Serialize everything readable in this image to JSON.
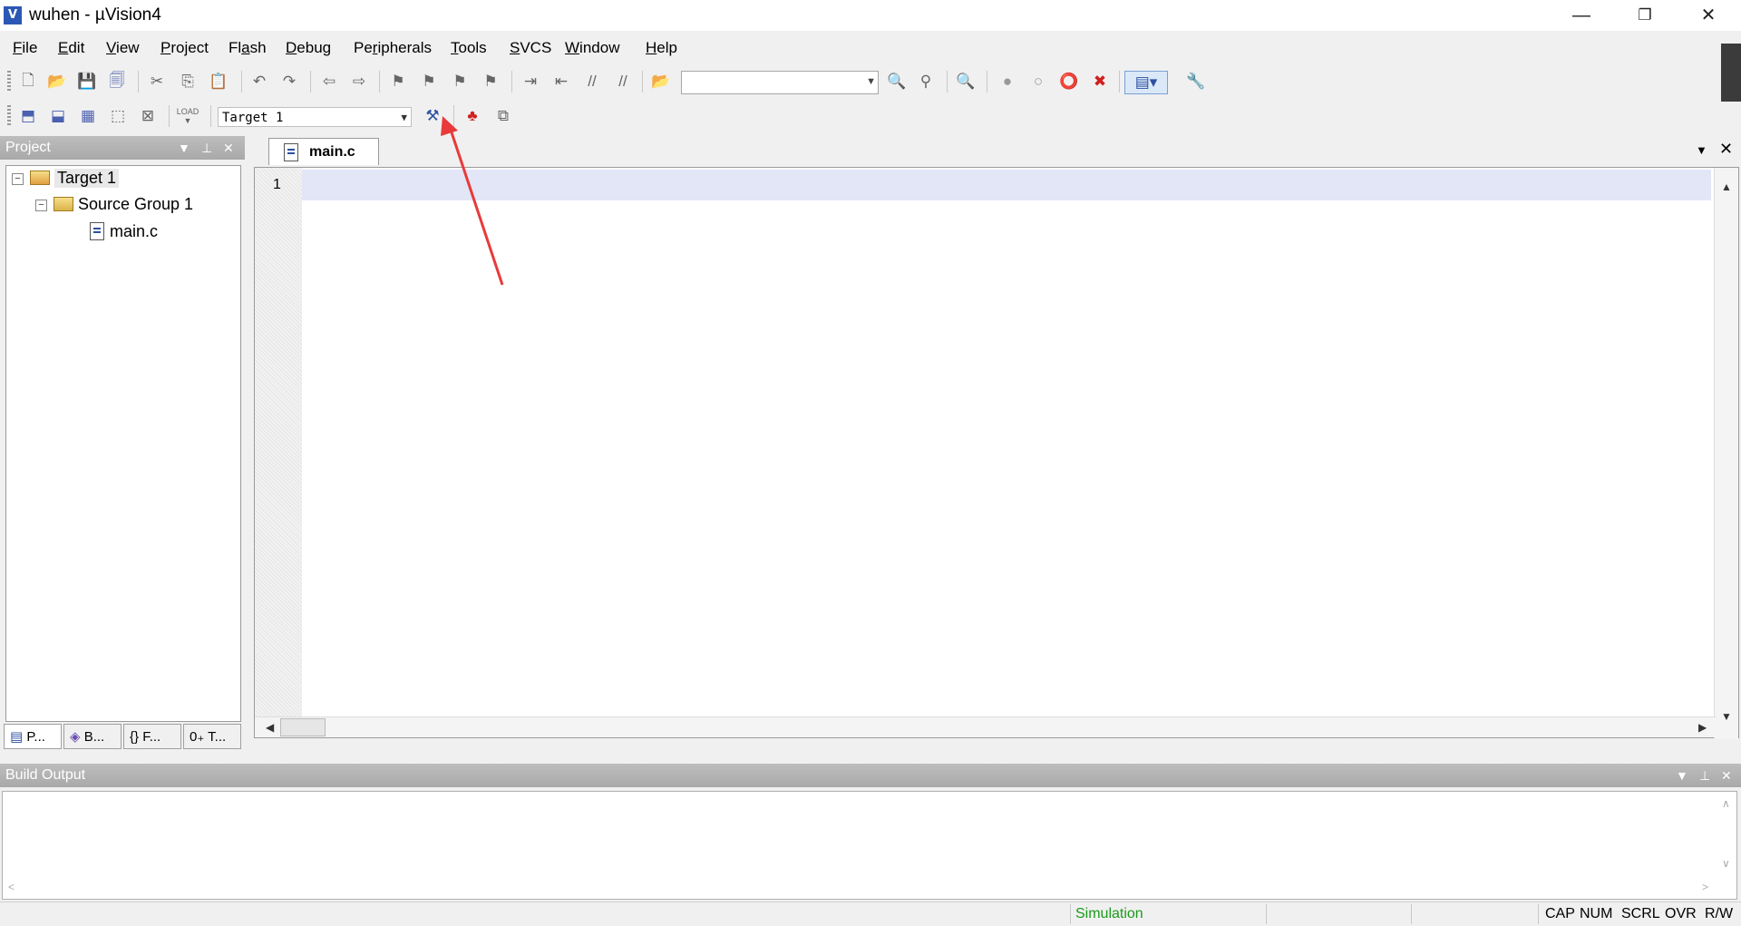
{
  "window": {
    "title": "wuhen  - µVision4",
    "app_icon_label": "V",
    "minimize_glyph": "—",
    "restore_glyph": "❐",
    "close_glyph": "✕"
  },
  "menu": [
    {
      "prefix": "",
      "key": "F",
      "rest": "ile"
    },
    {
      "prefix": "",
      "key": "E",
      "rest": "dit"
    },
    {
      "prefix": "",
      "key": "V",
      "rest": "iew"
    },
    {
      "prefix": "",
      "key": "P",
      "rest": "roject"
    },
    {
      "prefix": "Fl",
      "key": "a",
      "rest": "sh"
    },
    {
      "prefix": "",
      "key": "D",
      "rest": "ebug"
    },
    {
      "prefix": "Pe",
      "key": "r",
      "rest": "ipherals"
    },
    {
      "prefix": "",
      "key": "T",
      "rest": "ools"
    },
    {
      "prefix": "",
      "key": "S",
      "rest": "VCS"
    },
    {
      "prefix": "",
      "key": "W",
      "rest": "indow"
    },
    {
      "prefix": "",
      "key": "H",
      "rest": "elp"
    }
  ],
  "build_toolbar": {
    "load_label": "LOAD",
    "target_select_value": "Target 1"
  },
  "find_combo": {
    "value": ""
  },
  "project_pane": {
    "title": "Project",
    "tree": {
      "target": "Target 1",
      "group": "Source Group 1",
      "file": "main.c"
    },
    "tabs": [
      {
        "label": "P..."
      },
      {
        "label": "B..."
      },
      {
        "label": "F..."
      },
      {
        "label": "T..."
      }
    ],
    "tab_glyphs": [
      "▤",
      "◈",
      "{}",
      "0₊"
    ]
  },
  "editor": {
    "tab_label": "main.c",
    "line_numbers": [
      "1"
    ],
    "content": ""
  },
  "build_output": {
    "title": "Build Output",
    "content": ""
  },
  "status_bar": {
    "mode": "Simulation",
    "indicators": [
      "CAP",
      "NUM",
      "SCRL",
      "OVR",
      "R/W"
    ]
  },
  "colors": {
    "annotation_arrow": "#e83a3a",
    "current_line_highlight": "#e3e6f7",
    "status_mode_text": "#1a9b1a"
  }
}
